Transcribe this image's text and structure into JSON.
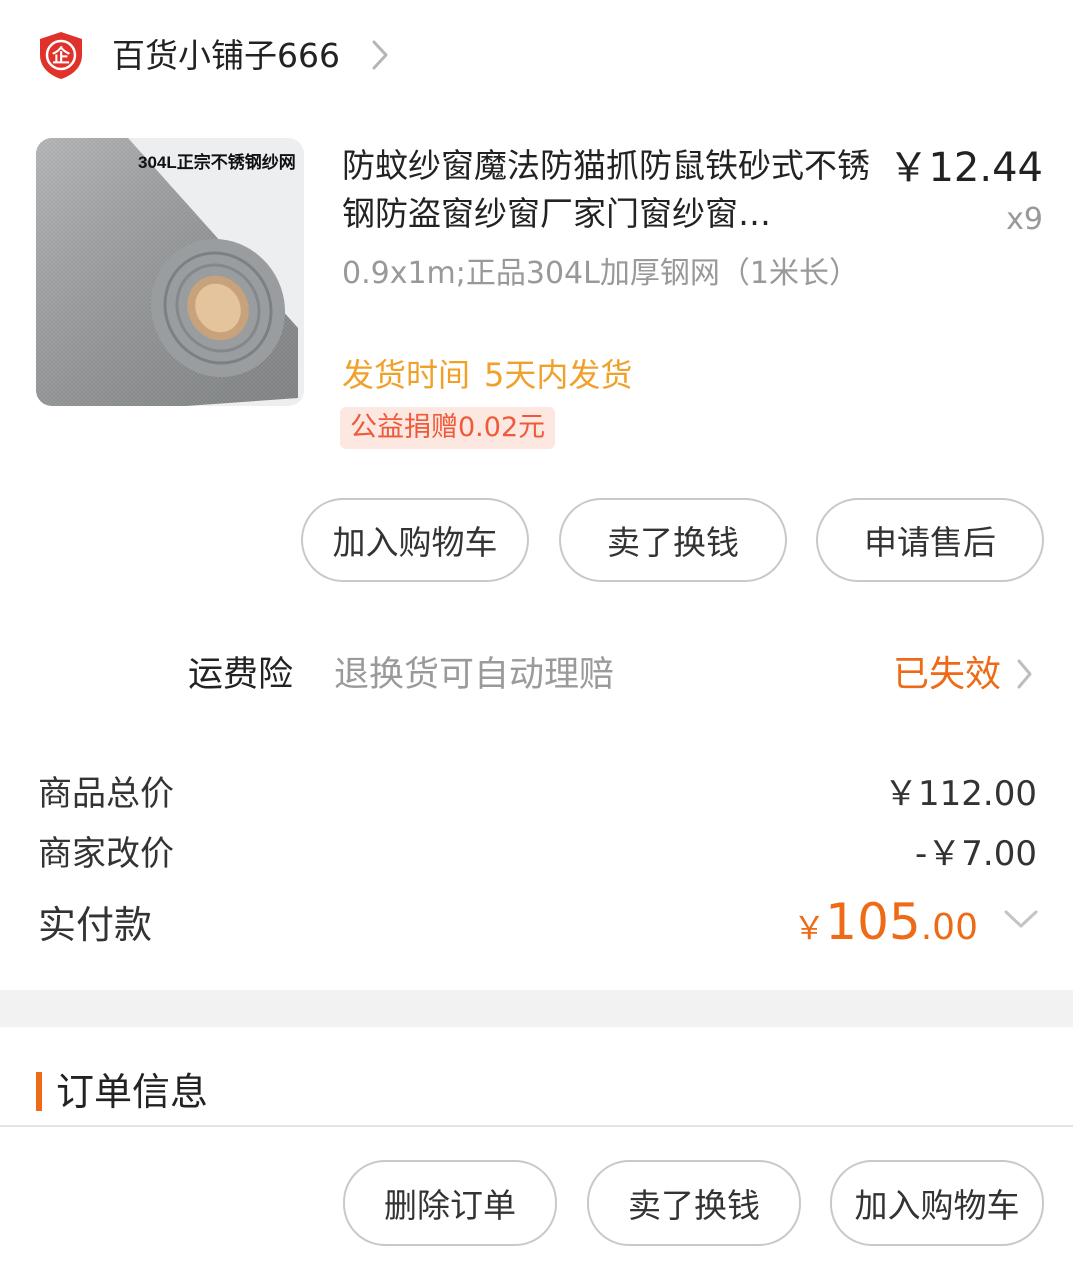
{
  "shop": {
    "badge_text": "企",
    "name": "百货小铺子666"
  },
  "product": {
    "image_caption": "304L正宗不锈钢纱网",
    "title": "防蚊纱窗魔法防猫抓防鼠铁砂式不锈钢防盗窗纱窗厂家门窗纱窗…",
    "price": "￥12.44",
    "quantity": "x9",
    "spec": "0.9x1m;正品304L加厚钢网（1米长）",
    "ship_label": "发货时间",
    "ship_value": "5天内发货",
    "charity": "公益捐赠0.02元"
  },
  "item_actions": {
    "add_to_cart": "加入购物车",
    "resell": "卖了换钱",
    "after_sale": "申请售后"
  },
  "freight_insurance": {
    "label": "运费险",
    "description": "退换货可自动理赔",
    "status": "已失效"
  },
  "summary": {
    "goods_total_label": "商品总价",
    "goods_total_value": "￥112.00",
    "seller_adjust_label": "商家改价",
    "seller_adjust_value": "-￥7.00",
    "paid_label": "实付款",
    "paid_currency": "￥",
    "paid_integer": "105",
    "paid_decimal": ".00"
  },
  "order_info": {
    "title": "订单信息"
  },
  "bottom_actions": {
    "delete_order": "删除订单",
    "resell": "卖了换钱",
    "add_to_cart": "加入购物车"
  },
  "colors": {
    "accent": "#ef6a16",
    "ship_text": "#f0a12a",
    "charity_text": "#ee5a3a",
    "charity_bg": "#fde7e1",
    "badge_red": "#e0312a",
    "muted_text": "#999999"
  }
}
